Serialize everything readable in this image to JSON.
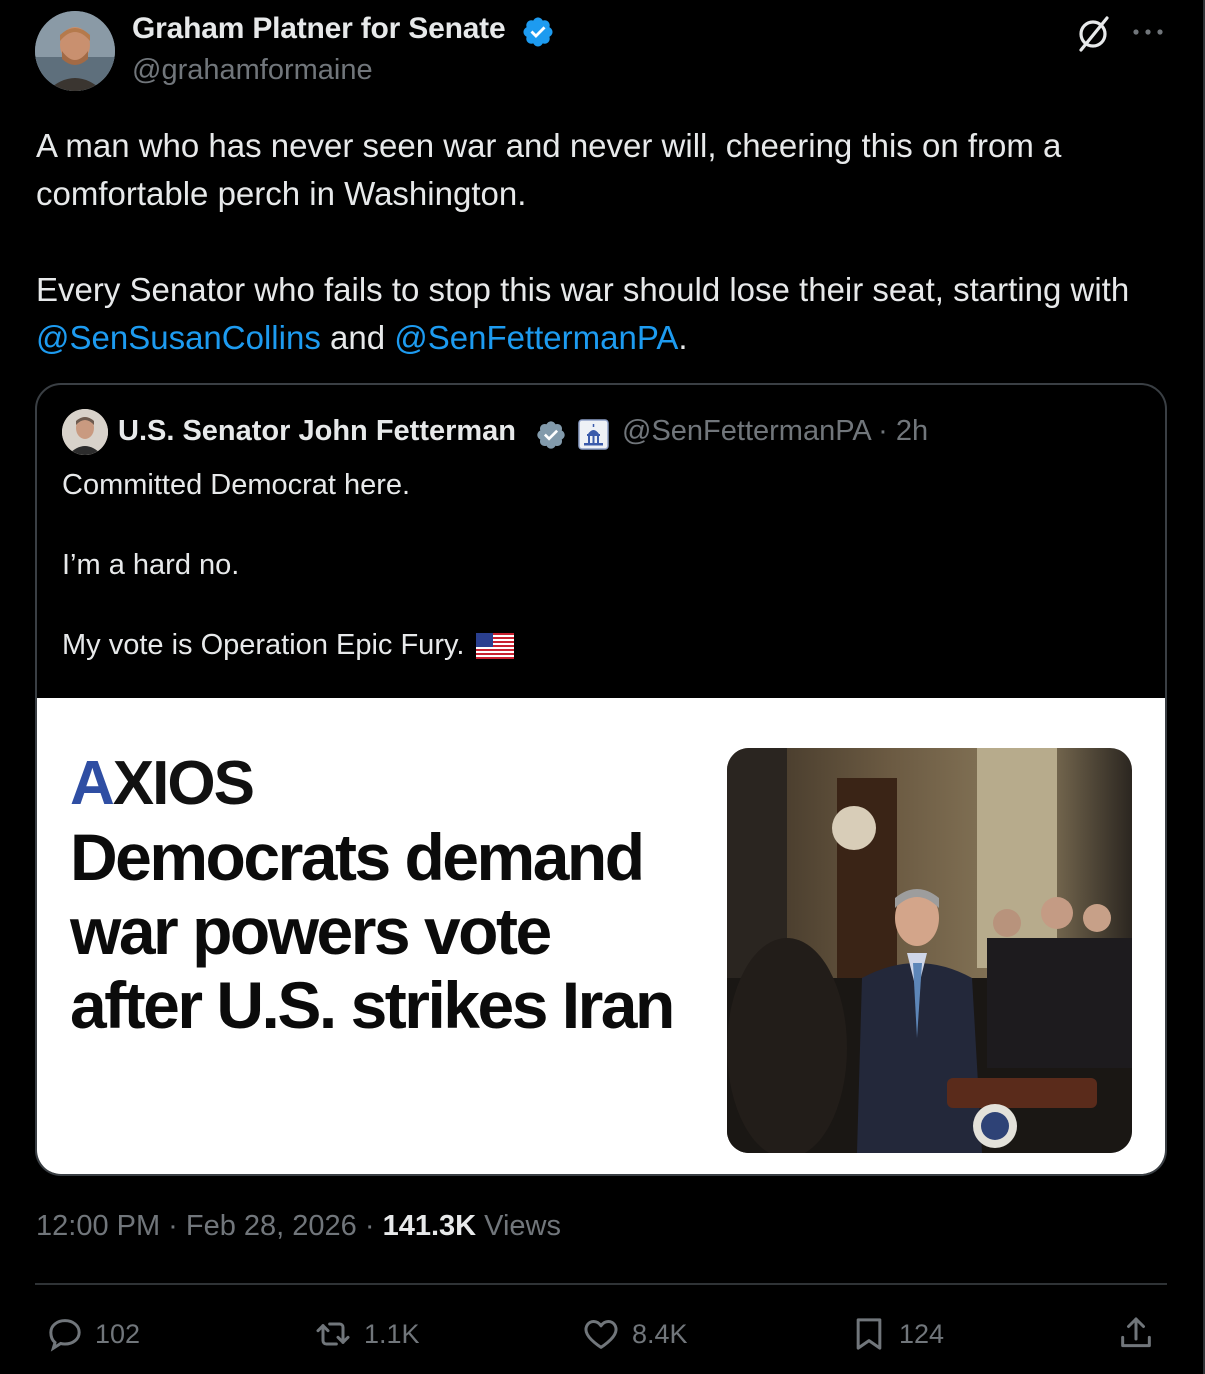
{
  "author": {
    "display_name": "Graham Platner for Senate",
    "handle": "@grahamformaine"
  },
  "tweet": {
    "line1": "A man who has never seen war and never will, cheering this on from a comfortable perch in Washington.",
    "line2_prefix": "Every Senator who fails to stop this war should lose their seat, starting with ",
    "mention1": "@SenSusanCollins",
    "joiner": " and ",
    "mention2": "@SenFettermanPA",
    "line2_suffix": "."
  },
  "quote": {
    "display_name": "U.S. Senator John Fetterman",
    "handle_time": "@SenFettermanPA · 2h",
    "line1": "Committed Democrat here.",
    "line2": "I’m a hard no.",
    "line3": "My vote is Operation Epic Fury.",
    "card": {
      "logo": "XIOS",
      "logo_first": "A",
      "headline": "Democrats demand war powers vote after U.S. strikes Iran"
    }
  },
  "meta": {
    "time_date": "12:00 PM · Feb 28, 2026 · ",
    "views_count": "141.3K",
    "views_label": " Views"
  },
  "actions": {
    "replies": "102",
    "reposts": "1.1K",
    "likes": "8.4K",
    "bookmarks": "124"
  },
  "colors": {
    "background": "#000000",
    "text": "#e7e9ea",
    "muted": "#71767b",
    "link": "#1d9bf0",
    "verified": "#1d9bf0",
    "axios_blue": "#2f4ea3"
  },
  "icons": [
    "verified-badge-icon",
    "grok-icon",
    "more-icon",
    "capitol-icon",
    "us-flag-icon",
    "reply-icon",
    "repost-icon",
    "like-icon",
    "bookmark-icon",
    "share-icon"
  ]
}
